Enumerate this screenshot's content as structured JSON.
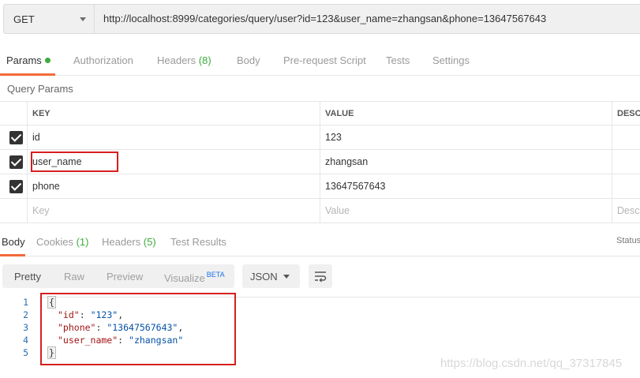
{
  "request": {
    "method": "GET",
    "url": "http://localhost:8999/categories/query/user?id=123&user_name=zhangsan&phone=13647567643"
  },
  "request_tabs": [
    {
      "label": "Params",
      "count": "",
      "active": true
    },
    {
      "label": "Authorization",
      "count": ""
    },
    {
      "label": "Headers",
      "count": "(8)"
    },
    {
      "label": "Body",
      "count": ""
    },
    {
      "label": "Pre-request Script",
      "count": ""
    },
    {
      "label": "Tests",
      "count": ""
    },
    {
      "label": "Settings",
      "count": ""
    }
  ],
  "query_params": {
    "section_label": "Query Params",
    "columns": {
      "key": "KEY",
      "value": "VALUE",
      "description": "DESCR"
    },
    "rows": [
      {
        "checked": true,
        "key": "id",
        "value": "123"
      },
      {
        "checked": true,
        "key": "user_name",
        "value": "zhangsan"
      },
      {
        "checked": true,
        "key": "phone",
        "value": "13647567643"
      }
    ],
    "placeholder": {
      "key": "Key",
      "value": "Value",
      "description": "Descr"
    }
  },
  "response_tabs": [
    {
      "label": "Body",
      "count": "",
      "active": true
    },
    {
      "label": "Cookies",
      "count": "(1)"
    },
    {
      "label": "Headers",
      "count": "(5)"
    },
    {
      "label": "Test Results",
      "count": ""
    }
  ],
  "status_label": "Status",
  "view_modes": {
    "pretty": "Pretty",
    "raw": "Raw",
    "preview": "Preview",
    "visualize": "Visualize",
    "beta": "BETA"
  },
  "format": "JSON",
  "response_body": {
    "line_numbers": [
      "1",
      "2",
      "3",
      "4",
      "5"
    ],
    "open_brace": "{",
    "close_brace": "}",
    "fields": [
      {
        "key": "\"id\"",
        "value": "\"123\"",
        "sep": ","
      },
      {
        "key": "\"phone\"",
        "value": "\"13647567643\"",
        "sep": ","
      },
      {
        "key": "\"user_name\"",
        "value": "\"zhangsan\"",
        "sep": ""
      }
    ]
  },
  "watermark": "https://blog.csdn.net/qq_37317845",
  "colors": {
    "accent": "#f26b3a",
    "count_green": "#3cac3c",
    "highlight_red": "#d6201f"
  }
}
